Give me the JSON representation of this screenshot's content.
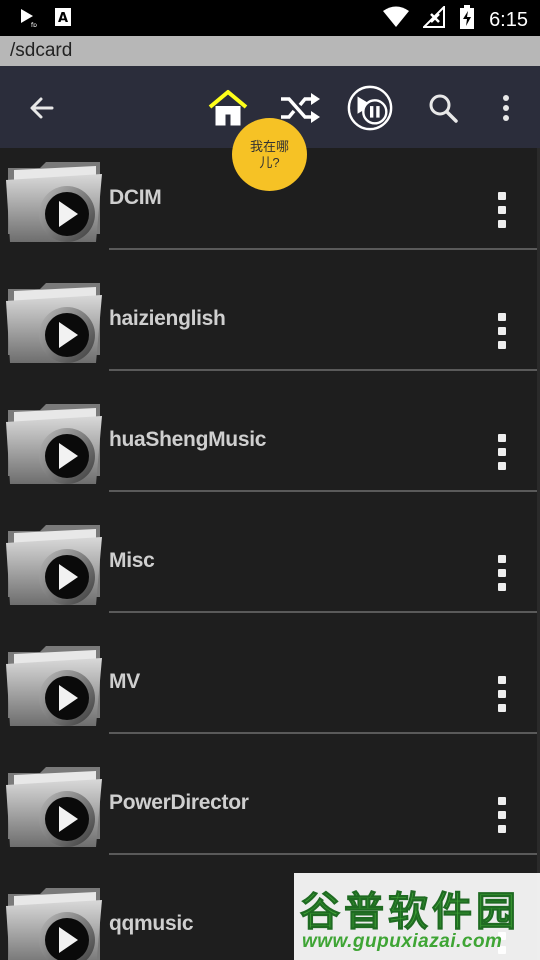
{
  "status_bar": {
    "time": "6:15",
    "left_icons": [
      "play-notification-icon",
      "a-notification-icon"
    ],
    "right_icons": [
      "wifi-icon",
      "no-signal-icon",
      "battery-charging-icon"
    ]
  },
  "path": "/sdcard",
  "toolbar": {
    "icons": [
      "back-arrow-icon",
      "home-icon",
      "shuffle-icon",
      "play-pause-icon",
      "search-icon",
      "overflow-menu-icon"
    ],
    "home_color": "#ffff1a",
    "tooltip": "我在哪儿?"
  },
  "folders": [
    {
      "name": "DCIM"
    },
    {
      "name": "haizienglish"
    },
    {
      "name": "huaShengMusic"
    },
    {
      "name": "Misc"
    },
    {
      "name": "MV"
    },
    {
      "name": "PowerDirector"
    },
    {
      "name": "qqmusic"
    }
  ],
  "watermark": {
    "title": "谷普软件园",
    "url": "www.gupuxiazai.com"
  },
  "colors": {
    "toolbar_bg": "#2b2d3b",
    "path_bg": "#b7b7b7",
    "list_bg": "#1e1e1e",
    "tooltip_bg": "#f6c225",
    "watermark_green": "#3fa535"
  }
}
